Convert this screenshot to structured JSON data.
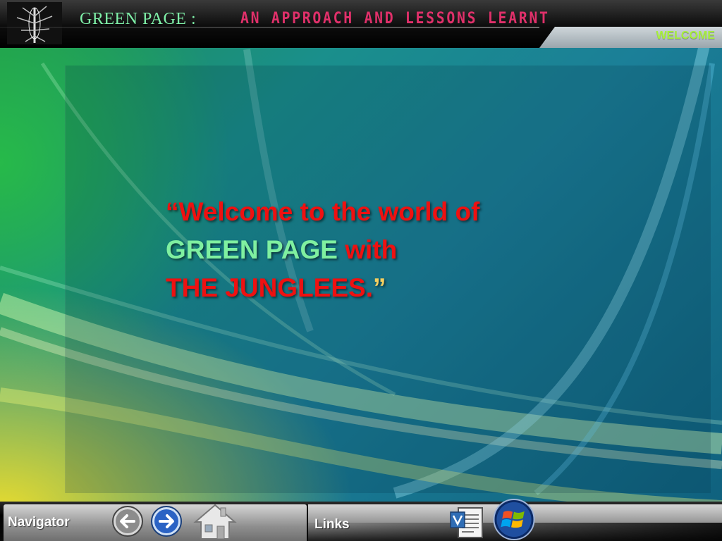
{
  "header": {
    "title_left": "GREEN PAGE  :",
    "title_right": "AN APPROACH AND LESSONS LEARNT",
    "section_tab": "WELCOME"
  },
  "message": {
    "line1": "“Welcome to the world of",
    "line2_green": "GREEN PAGE",
    "line2_red": " with",
    "line3": "THE JUNGLEES.",
    "closing_quote": "”"
  },
  "footer": {
    "navigator_label": "Navigator",
    "links_label": "Links"
  },
  "icons": {
    "logo": "tree-logo",
    "back": "back-arrow-icon",
    "forward": "forward-arrow-icon",
    "home": "home-icon",
    "document": "document-icon",
    "windows": "windows-logo-icon"
  },
  "colors": {
    "title_green": "#7ff0a8",
    "title_pink": "#e0306a",
    "welcome_green": "#a6f03a",
    "message_red": "#ee1111",
    "message_green": "#7ff0a0"
  }
}
